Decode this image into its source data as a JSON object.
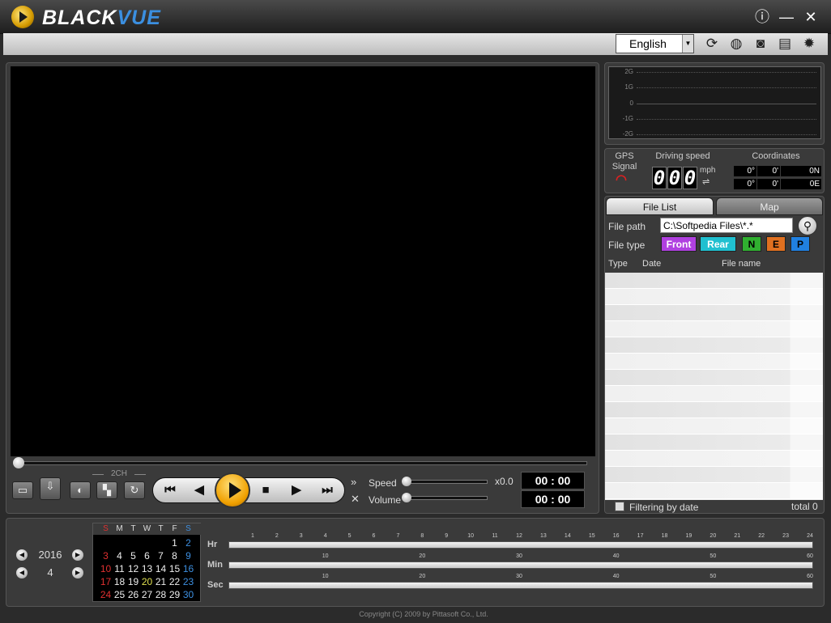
{
  "app": {
    "brand_left": "BLACK",
    "brand_right": "VUE",
    "window_buttons": [
      "info-icon",
      "minimize-icon",
      "close-icon"
    ]
  },
  "toolbar": {
    "language": "English",
    "icons": [
      "sd-card-sync-icon",
      "compass-icon",
      "camera-icon",
      "print-icon",
      "gear-icon"
    ]
  },
  "player": {
    "ch_label": "2CH",
    "speed_label": "Speed",
    "speed_value": "x0.0",
    "volume_label": "Volume",
    "time_current": "00 : 00",
    "time_total": "00 : 00",
    "seek_progress": 0,
    "speed_level": 0,
    "volume_level": 0
  },
  "gsensor": {
    "labels": [
      "2G",
      "1G",
      "0",
      "-1G",
      "-2G"
    ]
  },
  "gps": {
    "signal_label_1": "GPS",
    "signal_label_2": "Signal",
    "speed_label": "Driving speed",
    "coord_label": "Coordinates",
    "speed_digits": [
      "0",
      "0",
      "0"
    ],
    "speed_unit": "mph",
    "lat_deg": "0°",
    "lat_min": "0'",
    "lat_dir": "0N",
    "lon_deg": "0°",
    "lon_min": "0'",
    "lon_dir": "0E"
  },
  "files": {
    "tab_file_list": "File List",
    "tab_map": "Map",
    "path_label": "File path",
    "path_value": "C:\\Softpedia Files\\*.*",
    "type_label": "File type",
    "types": [
      "Front",
      "Rear",
      "N",
      "E",
      "P"
    ],
    "type_colors": [
      "#b040e0",
      "#20c0d0",
      "#30b030",
      "#e07020",
      "#2080e0"
    ],
    "col_type": "Type",
    "col_date": "Date",
    "col_name": "File name",
    "filter_label": "Filtering by date",
    "total_label": "total",
    "total_value": "0"
  },
  "calendar": {
    "year": "2016",
    "month": "4",
    "weekdays": [
      "S",
      "M",
      "T",
      "W",
      "T",
      "F",
      "S"
    ],
    "weeks": [
      [
        "",
        "",
        "",
        "",
        "",
        "1",
        "2"
      ],
      [
        "3",
        "4",
        "5",
        "6",
        "7",
        "8",
        "9"
      ],
      [
        "10",
        "11",
        "12",
        "13",
        "14",
        "15",
        "16"
      ],
      [
        "17",
        "18",
        "19",
        "20",
        "21",
        "22",
        "23"
      ],
      [
        "24",
        "25",
        "26",
        "27",
        "28",
        "29",
        "30"
      ]
    ]
  },
  "timeline": {
    "hr_label": "Hr",
    "min_label": "Min",
    "sec_label": "Sec",
    "hr_ticks": [
      "1",
      "2",
      "3",
      "4",
      "5",
      "6",
      "7",
      "8",
      "9",
      "10",
      "11",
      "12",
      "13",
      "14",
      "15",
      "16",
      "17",
      "18",
      "19",
      "20",
      "21",
      "22",
      "23",
      "24"
    ],
    "min_ticks": [
      "10",
      "20",
      "30",
      "40",
      "50",
      "60"
    ],
    "sec_ticks": [
      "10",
      "20",
      "30",
      "40",
      "50",
      "60"
    ]
  },
  "footer": {
    "copyright": "Copyright (C) 2009 by Pittasoft Co., Ltd."
  }
}
